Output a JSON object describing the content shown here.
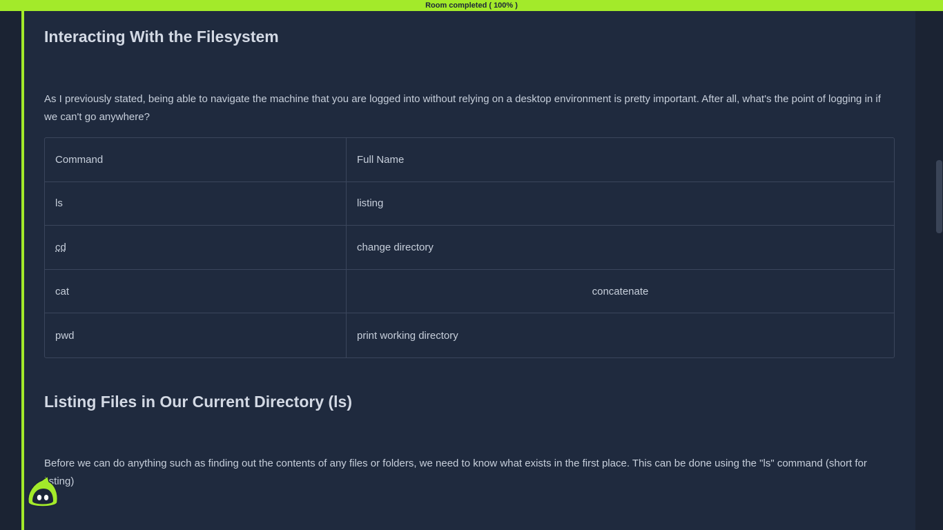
{
  "progress": {
    "label": "Room completed ( 100% )",
    "percent": 100,
    "color": "#a3ea2a"
  },
  "section_filesystem": {
    "heading": "Interacting With the Filesystem",
    "paragraph": "As I previously stated, being able to navigate the machine that you are logged into without relying on a desktop environment is pretty important. After all, what's the point of logging in if we can't go anywhere?"
  },
  "table": {
    "headers": [
      "Command",
      "Full Name"
    ],
    "rows": [
      {
        "command": "ls",
        "full_name": "listing"
      },
      {
        "command": "cd",
        "full_name": "change directory"
      },
      {
        "command": "cat",
        "full_name": "concatenate"
      },
      {
        "command": "pwd",
        "full_name": "print working directory"
      }
    ]
  },
  "section_listing": {
    "heading": "Listing Files in Our Current Directory (ls)",
    "paragraph": "Before we can do anything such as finding out the contents of any files or folders, we need to know what exists in the first place. This can be done using the \"ls\" command (short for listing)"
  },
  "mascot": {
    "icon": "thm-mascot-icon"
  }
}
